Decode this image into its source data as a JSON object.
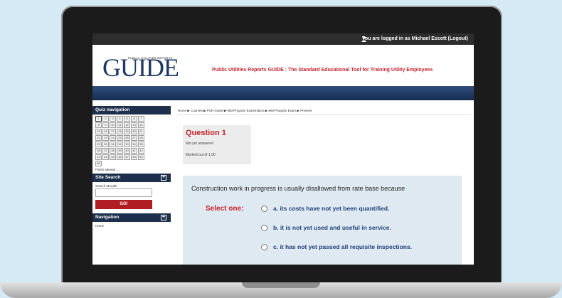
{
  "topbar": {
    "login_text": "You are logged in as Michael Escott (Logout)"
  },
  "header": {
    "logo_small": "PUBLIC UTILITIES REPORTS",
    "logo": "GUIDE",
    "tagline": "Public Utilities Reports GUIDE : The Standard Educational Tool for Training Utility Employees"
  },
  "quiz_nav": {
    "title": "Quiz navigation",
    "numbers": [
      "1",
      "2",
      "3",
      "4",
      "5",
      "6",
      "7",
      "8",
      "9",
      "10",
      "11",
      "12",
      "13",
      "14",
      "15",
      "16",
      "17",
      "18",
      "19",
      "20",
      "21",
      "22",
      "23",
      "24",
      "25",
      "26",
      "27",
      "28",
      "29",
      "30",
      "31",
      "32",
      "33",
      "34",
      "35",
      "36",
      "37",
      "38",
      "39",
      "40",
      "41",
      "42",
      "43",
      "44",
      "45",
      "46",
      "47",
      "48",
      "49",
      "50"
    ],
    "finish": "Finish attempt ..."
  },
  "site_search": {
    "title": "Site Search",
    "label": "Search Moodle",
    "button": "GO!"
  },
  "navigation": {
    "title": "Navigation",
    "home": "Home"
  },
  "breadcrumb": "Home ▶ Courses ▶ PUR Guide ▶ Mid-Program Examination ▶ Mid-Program Exam ▶ Preview",
  "question": {
    "title": "Question 1",
    "status": "Not yet answered",
    "marked": "Marked out of 1.00",
    "text": "Construction work in progress is usually disallowed from rate base because",
    "select_label": "Select one:",
    "answers": [
      "a. its costs have not yet been quantified.",
      "b. it is not yet used and useful in service.",
      "c. it has not yet passed all requisite inspections."
    ]
  }
}
